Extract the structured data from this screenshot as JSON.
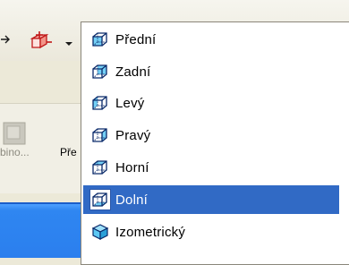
{
  "toolbar": {
    "arrow_icon": "arrow-right-icon",
    "transform_icon": "red-cube-transform-icon",
    "dropdown_icon": "chevron-down-icon",
    "combine_label": "bino...",
    "pre_label": "Pře"
  },
  "view_menu": {
    "items": [
      {
        "label": "Přední",
        "icon": "cube-front-icon",
        "selected": false
      },
      {
        "label": "Zadní",
        "icon": "cube-back-icon",
        "selected": false
      },
      {
        "label": "Levý",
        "icon": "cube-left-icon",
        "selected": false
      },
      {
        "label": "Pravý",
        "icon": "cube-right-icon",
        "selected": false
      },
      {
        "label": "Horní",
        "icon": "cube-top-icon",
        "selected": false
      },
      {
        "label": "Dolní",
        "icon": "cube-bottom-icon",
        "selected": true
      },
      {
        "label": "Izometrický",
        "icon": "cube-isometric-icon",
        "selected": false
      }
    ]
  },
  "colors": {
    "selection": "#316ac5",
    "cube_stroke": "#0a2a6a",
    "cube_fill": "#5cc8f4"
  }
}
